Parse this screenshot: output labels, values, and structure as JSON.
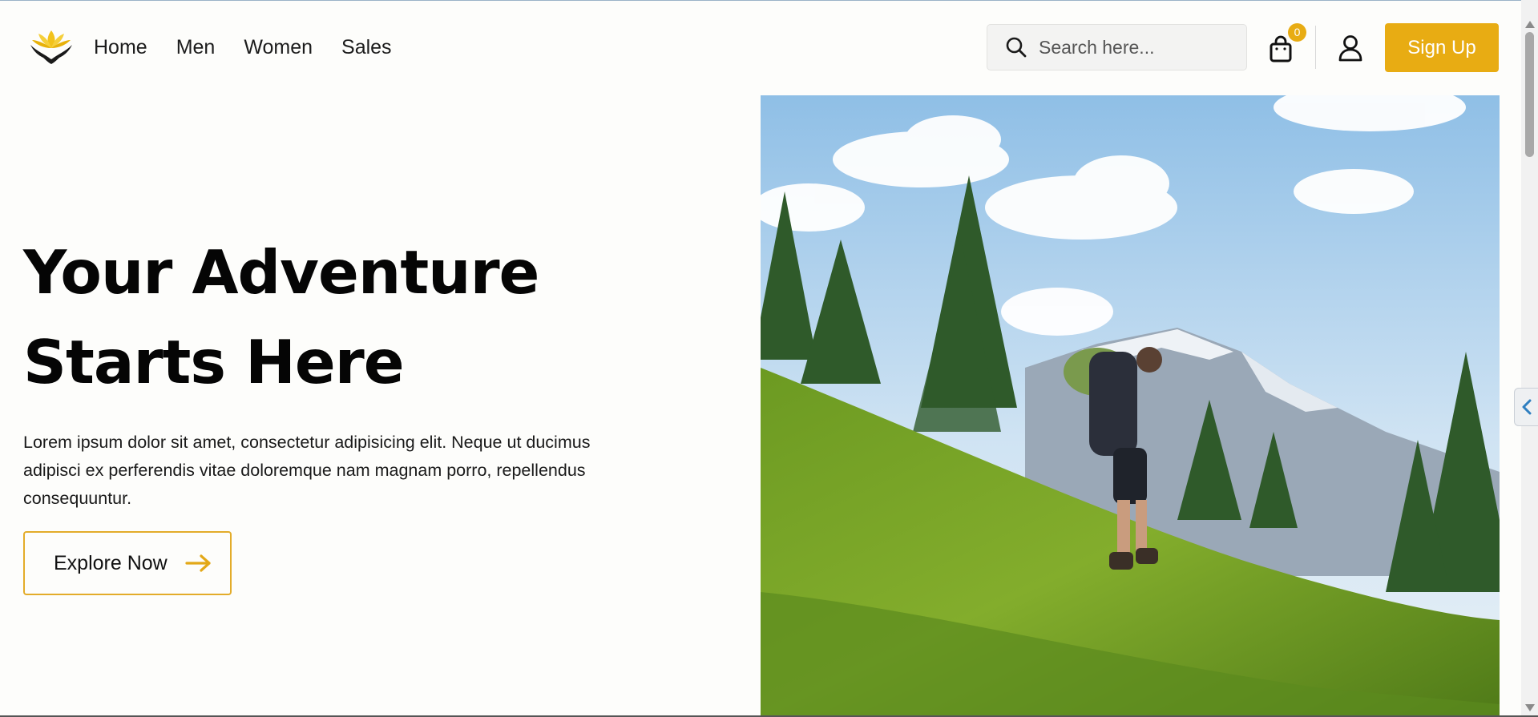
{
  "header": {
    "logo_icon": "lotus-hands-logo",
    "nav": [
      "Home",
      "Men",
      "Women",
      "Sales"
    ],
    "search": {
      "placeholder": "Search here...",
      "icon": "search-icon"
    },
    "cart": {
      "icon": "shopping-bag-icon",
      "count": "0"
    },
    "user_icon": "user-icon",
    "signup_label": "Sign Up"
  },
  "hero": {
    "title_line1": "Your Adventure",
    "title_line2": "Starts Here",
    "text": "Lorem ipsum dolor sit amet, consectetur adipisicing elit. Neque ut ducimus adipisci ex perferendis vitae doloremque nam magnam porro, repellendus consequuntur.",
    "cta_label": "Explore Now",
    "cta_icon": "arrow-right-icon",
    "image": "hiker-on-grassy-mountain-slope-photo"
  },
  "side_tab_icon": "chevron-left-icon",
  "colors": {
    "accent": "#e8ac13",
    "background": "#fdfdfb",
    "text": "#111111"
  }
}
